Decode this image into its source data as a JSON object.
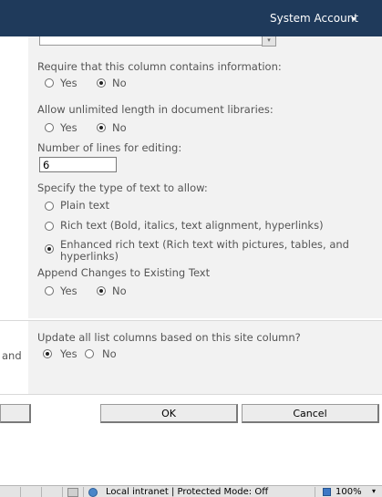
{
  "header": {
    "account_label": "System Account"
  },
  "form": {
    "required": {
      "label": "Require that this column contains information:",
      "options": [
        "Yes",
        "No"
      ],
      "selected": "No"
    },
    "unlimited_length": {
      "label": "Allow unlimited length in document libraries:",
      "options": [
        "Yes",
        "No"
      ],
      "selected": "No"
    },
    "lines": {
      "label": "Number of lines for editing:",
      "value": "6"
    },
    "text_type": {
      "label": "Specify the type of text to allow:",
      "options": [
        "Plain text",
        "Rich text (Bold, italics, text alignment, hyperlinks)",
        "Enhanced rich text (Rich text with pictures, tables, and",
        "hyperlinks)"
      ],
      "selected": "Enhanced rich text"
    },
    "append": {
      "label": "Append Changes to Existing Text",
      "options": [
        "Yes",
        "No"
      ],
      "selected": "No"
    },
    "update": {
      "side_text": "and",
      "label": "Update all list columns based on this site column?",
      "options": [
        "Yes",
        "No"
      ],
      "selected": "Yes"
    }
  },
  "buttons": {
    "ok": "OK",
    "cancel": "Cancel"
  },
  "statusbar": {
    "zone": "Local intranet | Protected Mode: Off",
    "zoom": "100%"
  }
}
